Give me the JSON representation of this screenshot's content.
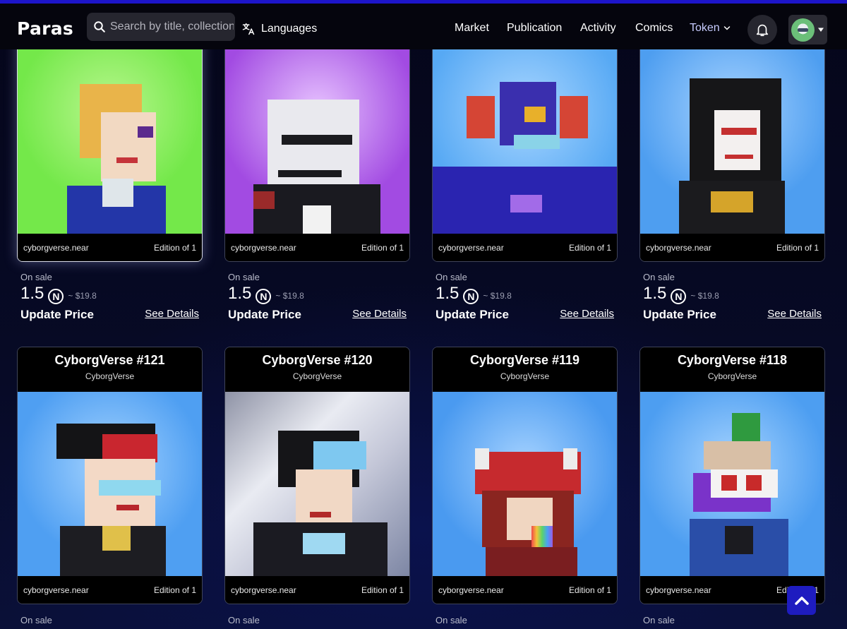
{
  "header": {
    "logo": "Paras",
    "search_placeholder": "Search by title, collection or artist",
    "languages_label": "Languages",
    "nav": [
      "Market",
      "Publication",
      "Activity",
      "Comics",
      "Token"
    ]
  },
  "top_cards": [
    {
      "owner": "cyborgverse.near",
      "edition": "Edition of 1",
      "sale_label": "On sale",
      "price": "1.5",
      "currency_symbol": "Ⓝ",
      "usd": "~ $19.8",
      "action": "Update Price",
      "details": "See Details",
      "bg_color": "#74e84a"
    },
    {
      "owner": "cyborgverse.near",
      "edition": "Edition of 1",
      "sale_label": "On sale",
      "price": "1.5",
      "currency_symbol": "Ⓝ",
      "usd": "~ $19.8",
      "action": "Update Price",
      "details": "See Details",
      "bg_color": "#a24be2"
    },
    {
      "owner": "cyborgverse.near",
      "edition": "Edition of 1",
      "sale_label": "On sale",
      "price": "1.5",
      "currency_symbol": "Ⓝ",
      "usd": "~ $19.8",
      "action": "Update Price",
      "details": "See Details",
      "bg_color": "#57a9f4"
    },
    {
      "owner": "cyborgverse.near",
      "edition": "Edition of 1",
      "sale_label": "On sale",
      "price": "1.5",
      "currency_symbol": "Ⓝ",
      "usd": "~ $19.8",
      "action": "Update Price",
      "details": "See Details",
      "bg_color": "#4e9ef0"
    }
  ],
  "bottom_cards": [
    {
      "title": "CyborgVerse #121",
      "collection": "CyborgVerse",
      "owner": "cyborgverse.near",
      "edition": "Edition of 1",
      "sale_label": "On sale",
      "bg_color": "#4f9ff2"
    },
    {
      "title": "CyborgVerse #120",
      "collection": "CyborgVerse",
      "owner": "cyborgverse.near",
      "edition": "Edition of 1",
      "sale_label": "On sale",
      "bg_color": "#c9ccd6"
    },
    {
      "title": "CyborgVerse #119",
      "collection": "CyborgVerse",
      "owner": "cyborgverse.near",
      "edition": "Edition of 1",
      "sale_label": "On sale",
      "bg_color": "#4a9af0"
    },
    {
      "title": "CyborgVerse #118",
      "collection": "CyborgVerse",
      "owner": "cyborgverse.near",
      "edition": "Edition of 1",
      "sale_label": "On sale",
      "bg_color": "#4d9ef1"
    }
  ]
}
